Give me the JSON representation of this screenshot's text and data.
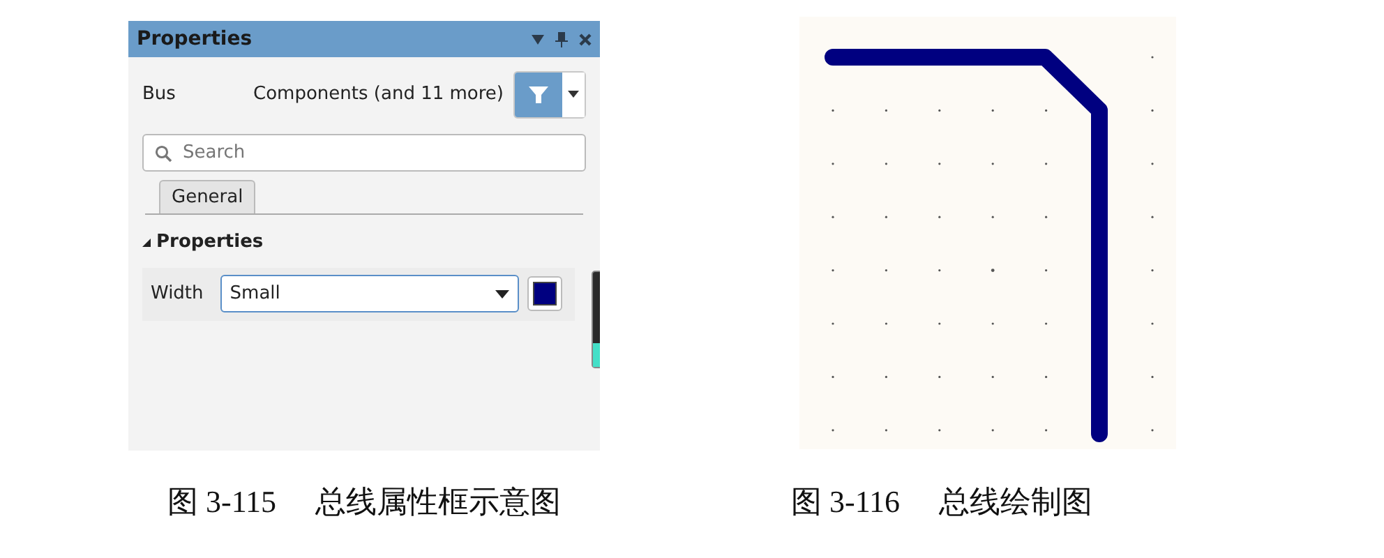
{
  "panel": {
    "title": "Properties",
    "object_type": "Bus",
    "filter_label": "Components (and 11 more)",
    "search": {
      "placeholder": "Search"
    },
    "tabs": [
      {
        "label": "General",
        "selected": true
      }
    ],
    "section": {
      "title": "Properties",
      "expanded": true
    },
    "width_field": {
      "label": "Width",
      "value": "Small",
      "color": "#000080"
    }
  },
  "canvas": {
    "kind": "bus-drawing"
  },
  "captions": [
    {
      "number": "图 3-115",
      "title": "总线属性框示意图"
    },
    {
      "number": "图 3-116",
      "title": "总线绘制图"
    }
  ]
}
